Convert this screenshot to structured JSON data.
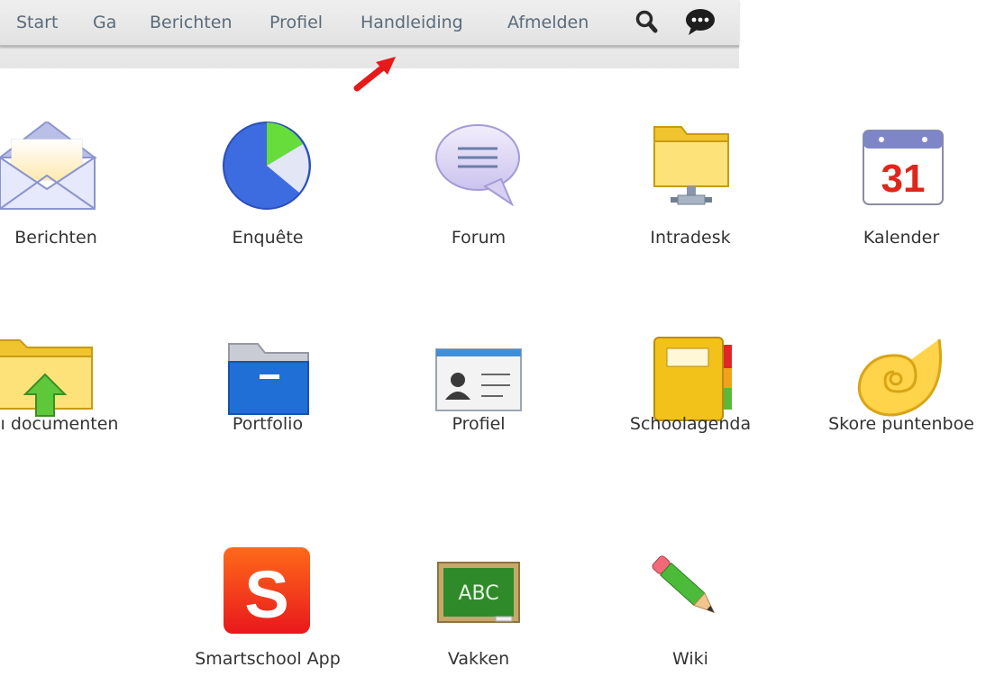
{
  "menu": {
    "items": [
      {
        "key": "start",
        "label": "Start"
      },
      {
        "key": "ga",
        "label": "Ga"
      },
      {
        "key": "berichten",
        "label": "Berichten"
      },
      {
        "key": "profiel",
        "label": "Profiel"
      },
      {
        "key": "handleiding",
        "label": "Handleiding"
      },
      {
        "key": "afmelden",
        "label": "Afmelden"
      }
    ],
    "search_icon": "search-icon",
    "chat_icon": "chat-bubble-icon"
  },
  "annotation": {
    "arrow_icon": "red-arrow-icon",
    "arrow_color": "#e8191a"
  },
  "apps": [
    {
      "label": "Berichten",
      "icon": "envelope-icon"
    },
    {
      "label": "Enquête",
      "icon": "pie-chart-icon"
    },
    {
      "label": "Forum",
      "icon": "speech-bubble-icon"
    },
    {
      "label": "Intradesk",
      "icon": "network-folder-icon"
    },
    {
      "label": "Kalender",
      "icon": "calendar-icon",
      "icon_text": "31"
    },
    {
      "label": "ı documenten",
      "icon": "upload-folder-icon"
    },
    {
      "label": "Portfolio",
      "icon": "blue-folder-icon"
    },
    {
      "label": "Profiel",
      "icon": "id-card-icon"
    },
    {
      "label": "Schoolagenda",
      "icon": "agenda-book-icon"
    },
    {
      "label": "Skore puntenboe",
      "icon": "shell-icon"
    },
    {
      "label": "Smartschool App",
      "icon": "smartschool-logo-icon",
      "icon_text": "S"
    },
    {
      "label": "Vakken",
      "icon": "chalkboard-icon",
      "icon_text": "ABC"
    },
    {
      "label": "Wiki",
      "icon": "pencil-icon"
    }
  ]
}
